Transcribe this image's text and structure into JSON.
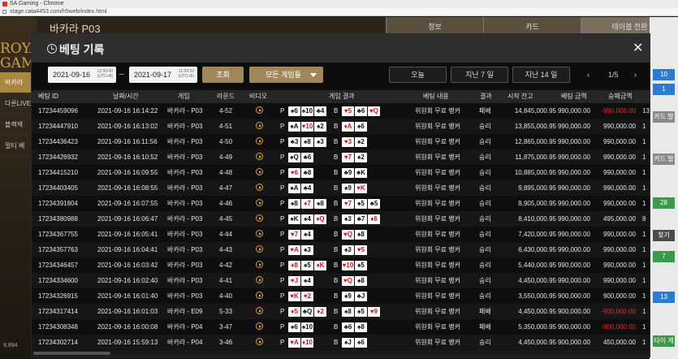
{
  "browser": {
    "title": "SA Gaming - Chrome",
    "url": "stage.cata4453.com/h5web/index.html"
  },
  "background": {
    "logo_line1": "ROYA",
    "logo_line2": "GAM",
    "table_title": "바카라 P03",
    "tabs": [
      "정보",
      "카드",
      "테이블 전환"
    ],
    "side_items": [
      "바카라",
      "다른LIVE",
      "블랙잭",
      "멀티 베"
    ],
    "balance": "9,894",
    "right_cells": [
      {
        "label": "10",
        "color": "#2c7bd0"
      },
      {
        "label": "1",
        "color": "#2c7bd0"
      },
      {
        "label": "카드 발",
        "color": "#8a8a8a"
      },
      {
        "label": "카드 발",
        "color": "#8a8a8a"
      },
      {
        "label": "28",
        "color": "#3a9a4a"
      },
      {
        "label": "찾기",
        "color": "#4a4a4a"
      },
      {
        "label": "7",
        "color": "#3a9a4a"
      },
      {
        "label": "13",
        "color": "#2c7bd0"
      },
      {
        "label": "타이 게",
        "color": "#3a9a4a"
      }
    ]
  },
  "modal": {
    "title": "베팅 기록",
    "filters": {
      "date_from": "2021-09-16",
      "date_from_time": "12:00:00",
      "date_to": "2021-09-17",
      "date_to_time": "11:59:59",
      "utc": "(UTC+8)",
      "search_label": "조회",
      "game_select": "모든 게임들",
      "today_label": "오늘",
      "last7_label": "지난 7 일",
      "last14_label": "지난 14 일",
      "prev_page": "‹",
      "next_page": "›",
      "page": "1/5"
    },
    "columns": [
      "베팅 ID",
      "날짜/시간",
      "게임",
      "라운드",
      "비디오",
      "게임 결과",
      "베팅 내용",
      "결과",
      "시작 잔고",
      "베팅 금액",
      "승패금액"
    ],
    "rows": [
      {
        "id": "17234459096",
        "dt": "2021-09-16 16:14:22",
        "game": "바카라 - P03",
        "round": "4-52",
        "p": [
          {
            "r": "6",
            "s": "♠",
            "c": "black"
          },
          {
            "r": "10",
            "s": "♠",
            "c": "black"
          },
          {
            "r": "4",
            "s": "♣",
            "c": "black"
          }
        ],
        "b": [
          {
            "r": "5",
            "s": "♥",
            "c": "red"
          },
          {
            "r": "6",
            "s": "♣",
            "c": "black"
          },
          {
            "r": "Q",
            "s": "♥",
            "c": "red"
          }
        ],
        "bet": "위원회 무료 뱅커",
        "res": "패배",
        "bal": "14,845,000.95",
        "amt": "990,000.00",
        "wl": "-990,000.00",
        "neg": true,
        "extra": "13"
      },
      {
        "id": "17234447910",
        "dt": "2021-09-16 16:13:02",
        "game": "바카라 - P03",
        "round": "4-51",
        "p": [
          {
            "r": "A",
            "s": "♠",
            "c": "black"
          },
          {
            "r": "10",
            "s": "♥",
            "c": "red"
          },
          {
            "r": "2",
            "s": "♠",
            "c": "black"
          }
        ],
        "b": [
          {
            "r": "A",
            "s": "♦",
            "c": "red"
          },
          {
            "r": "6",
            "s": "♠",
            "c": "black"
          }
        ],
        "bet": "위원회 무료 뱅커",
        "res": "승리",
        "bal": "13,855,000.95",
        "amt": "990,000.00",
        "wl": "990,000.00",
        "neg": false,
        "extra": "1"
      },
      {
        "id": "17234436423",
        "dt": "2021-09-16 16:11:56",
        "game": "바카라 - P03",
        "round": "4-50",
        "p": [
          {
            "r": "3",
            "s": "♣",
            "c": "black"
          },
          {
            "r": "8",
            "s": "♠",
            "c": "black"
          },
          {
            "r": "3",
            "s": "♠",
            "c": "black"
          }
        ],
        "b": [
          {
            "r": "3",
            "s": "♥",
            "c": "red"
          },
          {
            "r": "2",
            "s": "♠",
            "c": "black"
          }
        ],
        "bet": "위원회 무료 뱅커",
        "res": "승리",
        "bal": "12,865,000.95",
        "amt": "990,000.00",
        "wl": "990,000.00",
        "neg": false,
        "extra": "1"
      },
      {
        "id": "17234426932",
        "dt": "2021-09-16 16:10:52",
        "game": "바카라 - P03",
        "round": "4-49",
        "p": [
          {
            "r": "Q",
            "s": "♠",
            "c": "black"
          },
          {
            "r": "6",
            "s": "♣",
            "c": "black"
          }
        ],
        "b": [
          {
            "r": "7",
            "s": "♥",
            "c": "red"
          },
          {
            "r": "2",
            "s": "♠",
            "c": "black"
          }
        ],
        "bet": "위원회 무료 뱅커",
        "res": "승리",
        "bal": "11,875,000.95",
        "amt": "990,000.00",
        "wl": "990,000.00",
        "neg": false,
        "extra": "1"
      },
      {
        "id": "17234415210",
        "dt": "2021-09-16 16:09:55",
        "game": "바카라 - P03",
        "round": "4-48",
        "p": [
          {
            "r": "6",
            "s": "♥",
            "c": "red"
          },
          {
            "r": "8",
            "s": "♣",
            "c": "black"
          }
        ],
        "b": [
          {
            "r": "9",
            "s": "♣",
            "c": "black"
          },
          {
            "r": "K",
            "s": "♣",
            "c": "black"
          }
        ],
        "bet": "위원회 무료 뱅커",
        "res": "승리",
        "bal": "10,885,000.95",
        "amt": "990,000.00",
        "wl": "990,000.00",
        "neg": false,
        "extra": "1"
      },
      {
        "id": "17234403405",
        "dt": "2021-09-16 16:08:55",
        "game": "바카라 - P03",
        "round": "4-47",
        "p": [
          {
            "r": "A",
            "s": "♠",
            "c": "black"
          },
          {
            "r": "4",
            "s": "♣",
            "c": "black"
          }
        ],
        "b": [
          {
            "r": "9",
            "s": "♠",
            "c": "black"
          },
          {
            "r": "K",
            "s": "♥",
            "c": "red"
          }
        ],
        "bet": "위원회 무료 뱅커",
        "res": "승리",
        "bal": "9,895,000.95",
        "amt": "990,000.00",
        "wl": "990,000.00",
        "neg": false,
        "extra": "1"
      },
      {
        "id": "17234391804",
        "dt": "2021-09-16 16:07:55",
        "game": "바카라 - P03",
        "round": "4-46",
        "p": [
          {
            "r": "8",
            "s": "♠",
            "c": "black"
          },
          {
            "r": "7",
            "s": "♦",
            "c": "red"
          },
          {
            "r": "8",
            "s": "♠",
            "c": "black"
          }
        ],
        "b": [
          {
            "r": "7",
            "s": "♥",
            "c": "red"
          },
          {
            "r": "5",
            "s": "♠",
            "c": "black"
          },
          {
            "r": "5",
            "s": "♣",
            "c": "black"
          }
        ],
        "bet": "위원회 무료 뱅커",
        "res": "승리",
        "bal": "8,905,000.95",
        "amt": "990,000.00",
        "wl": "990,000.00",
        "neg": false,
        "extra": "1"
      },
      {
        "id": "17234380988",
        "dt": "2021-09-16 16:06:47",
        "game": "바카라 - P03",
        "round": "4-45",
        "p": [
          {
            "r": "K",
            "s": "♠",
            "c": "black"
          },
          {
            "r": "4",
            "s": "♠",
            "c": "black"
          },
          {
            "r": "Q",
            "s": "♦",
            "c": "red"
          }
        ],
        "b": [
          {
            "r": "3",
            "s": "♠",
            "c": "black"
          },
          {
            "r": "7",
            "s": "♣",
            "c": "black"
          },
          {
            "r": "6",
            "s": "♦",
            "c": "red"
          }
        ],
        "bet": "위원회 무료 뱅커",
        "res": "승리",
        "bal": "8,410,000.95",
        "amt": "990,000.00",
        "wl": "495,000.00",
        "neg": false,
        "extra": "8"
      },
      {
        "id": "17234367755",
        "dt": "2021-09-16 16:05:41",
        "game": "바카라 - P03",
        "round": "4-44",
        "p": [
          {
            "r": "7",
            "s": "♥",
            "c": "red"
          },
          {
            "r": "4",
            "s": "♠",
            "c": "black"
          }
        ],
        "b": [
          {
            "r": "Q",
            "s": "♥",
            "c": "red"
          },
          {
            "r": "8",
            "s": "♠",
            "c": "black"
          }
        ],
        "bet": "위원회 무료 뱅커",
        "res": "승리",
        "bal": "7,420,000.95",
        "amt": "990,000.00",
        "wl": "990,000.00",
        "neg": false,
        "extra": "1"
      },
      {
        "id": "17234357763",
        "dt": "2021-09-16 16:04:41",
        "game": "바카라 - P03",
        "round": "4-43",
        "p": [
          {
            "r": "A",
            "s": "♥",
            "c": "red"
          },
          {
            "r": "3",
            "s": "♠",
            "c": "black"
          }
        ],
        "b": [
          {
            "r": "3",
            "s": "♠",
            "c": "black"
          },
          {
            "r": "5",
            "s": "♥",
            "c": "red"
          }
        ],
        "bet": "위원회 무료 뱅커",
        "res": "승리",
        "bal": "6,430,000.95",
        "amt": "990,000.00",
        "wl": "990,000.00",
        "neg": false,
        "extra": "1"
      },
      {
        "id": "17234346457",
        "dt": "2021-09-16 16:03:42",
        "game": "바카라 - P03",
        "round": "4-42",
        "p": [
          {
            "r": "8",
            "s": "♦",
            "c": "red"
          },
          {
            "r": "5",
            "s": "♠",
            "c": "black"
          },
          {
            "r": "K",
            "s": "♦",
            "c": "red"
          }
        ],
        "b": [
          {
            "r": "10",
            "s": "♥",
            "c": "red"
          },
          {
            "r": "5",
            "s": "♠",
            "c": "black"
          }
        ],
        "bet": "위원회 무료 뱅커",
        "res": "승리",
        "bal": "5,440,000.95",
        "amt": "990,000.00",
        "wl": "990,000.00",
        "neg": false,
        "extra": "1"
      },
      {
        "id": "17234334600",
        "dt": "2021-09-16 16:02:40",
        "game": "바카라 - P03",
        "round": "4-41",
        "p": [
          {
            "r": "J",
            "s": "♥",
            "c": "red"
          },
          {
            "r": "4",
            "s": "♠",
            "c": "black"
          }
        ],
        "b": [
          {
            "r": "Q",
            "s": "♥",
            "c": "red"
          },
          {
            "r": "8",
            "s": "♠",
            "c": "black"
          }
        ],
        "bet": "위원회 무료 뱅커",
        "res": "승리",
        "bal": "4,450,000.95",
        "amt": "990,000.00",
        "wl": "990,000.00",
        "neg": false,
        "extra": "1"
      },
      {
        "id": "17234326915",
        "dt": "2021-09-16 16:01:40",
        "game": "바카라 - P03",
        "round": "4-40",
        "p": [
          {
            "r": "K",
            "s": "♥",
            "c": "red"
          },
          {
            "r": "2",
            "s": "♥",
            "c": "red"
          }
        ],
        "b": [
          {
            "r": "9",
            "s": "♠",
            "c": "black"
          },
          {
            "r": "J",
            "s": "♣",
            "c": "black"
          }
        ],
        "bet": "위원회 무료 뱅커",
        "res": "승리",
        "bal": "3,550,000.95",
        "amt": "900,000.00",
        "wl": "900,000.00",
        "neg": false,
        "extra": "1"
      },
      {
        "id": "17234317414",
        "dt": "2021-09-16 16:01:03",
        "game": "바카라 - E09",
        "round": "5-33",
        "p": [
          {
            "r": "5",
            "s": "♦",
            "c": "red"
          },
          {
            "r": "Q",
            "s": "♣",
            "c": "black"
          },
          {
            "r": "2",
            "s": "♦",
            "c": "red"
          }
        ],
        "b": [
          {
            "r": "8",
            "s": "♠",
            "c": "black"
          },
          {
            "r": "5",
            "s": "♠",
            "c": "black"
          },
          {
            "r": "9",
            "s": "♥",
            "c": "red"
          }
        ],
        "bet": "위원회 무료 뱅커",
        "res": "패배",
        "bal": "4,450,000.95",
        "amt": "900,000.00",
        "wl": "-900,000.00",
        "neg": true,
        "extra": "1"
      },
      {
        "id": "17234308348",
        "dt": "2021-09-16 16:00:08",
        "game": "바카라 - P04",
        "round": "3-47",
        "p": [
          {
            "r": "6",
            "s": "♠",
            "c": "black"
          },
          {
            "r": "10",
            "s": "♠",
            "c": "black"
          }
        ],
        "b": [
          {
            "r": "6",
            "s": "♣",
            "c": "black"
          },
          {
            "r": "8",
            "s": "♠",
            "c": "black"
          }
        ],
        "bet": "위원회 무료 뱅커",
        "res": "패배",
        "bal": "5,350,000.95",
        "amt": "900,000.00",
        "wl": "-900,000.00",
        "neg": true,
        "extra": "1"
      },
      {
        "id": "17234302714",
        "dt": "2021-09-16 15:59:13",
        "game": "바카라 - P04",
        "round": "3-46",
        "p": [
          {
            "r": "A",
            "s": "♥",
            "c": "red"
          },
          {
            "r": "10",
            "s": "♦",
            "c": "red"
          }
        ],
        "b": [
          {
            "r": "J",
            "s": "♠",
            "c": "black"
          },
          {
            "r": "6",
            "s": "♠",
            "c": "black"
          }
        ],
        "bet": "위원회 무료 뱅커",
        "res": "승리",
        "bal": "4,450,000.95",
        "amt": "900,000.00",
        "wl": "450,000.00",
        "neg": false,
        "extra": "1"
      }
    ]
  }
}
